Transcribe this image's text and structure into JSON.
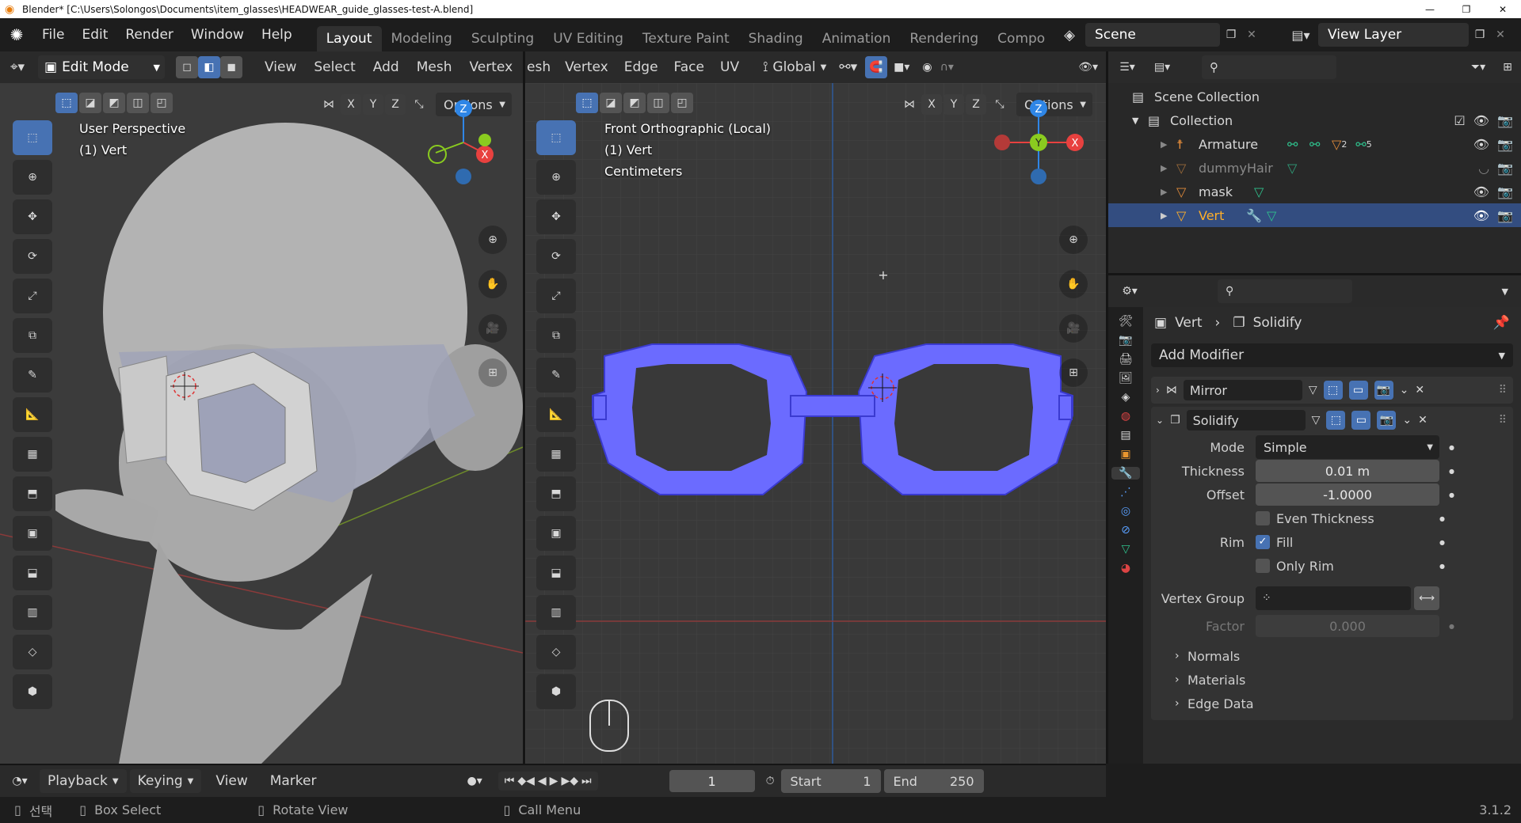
{
  "titlebar": {
    "text": "Blender* [C:\\Users\\Solongos\\Documents\\item_glasses\\HEADWEAR_guide_glasses-test-A.blend]"
  },
  "menu": [
    "File",
    "Edit",
    "Render",
    "Window",
    "Help"
  ],
  "workspaces": [
    "Layout",
    "Modeling",
    "Sculpting",
    "UV Editing",
    "Texture Paint",
    "Shading",
    "Animation",
    "Rendering",
    "Compo"
  ],
  "scene": {
    "name": "Scene",
    "view_layer": "View Layer"
  },
  "left_view": {
    "mode": "Edit Mode",
    "menus": [
      "View",
      "Select",
      "Add",
      "Mesh",
      "Vertex"
    ],
    "options": "Options",
    "info": [
      "User Perspective",
      "(1) Vert"
    ],
    "axes": [
      "X",
      "Y",
      "Z"
    ]
  },
  "right_view": {
    "menus": [
      "esh",
      "Vertex",
      "Edge",
      "Face",
      "UV"
    ],
    "orientation": "Global",
    "options": "Options",
    "info": [
      "Front Orthographic (Local)",
      "(1) Vert",
      "Centimeters"
    ],
    "axes": [
      "X",
      "Y",
      "Z"
    ]
  },
  "gizmo": {
    "x": "X",
    "y": "Y",
    "z": "Z"
  },
  "outliner": {
    "scene_collection": "Scene Collection",
    "collection": "Collection",
    "items": [
      {
        "name": "Armature",
        "badge1": "2",
        "badge2": "5"
      },
      {
        "name": "dummyHair"
      },
      {
        "name": "mask"
      },
      {
        "name": "Vert"
      }
    ]
  },
  "properties": {
    "breadcrumb_object": "Vert",
    "breadcrumb_modifier": "Solidify",
    "add_modifier": "Add Modifier",
    "modifiers": [
      {
        "name": "Mirror"
      },
      {
        "name": "Solidify"
      }
    ],
    "mode_label": "Mode",
    "mode_value": "Simple",
    "thickness_label": "Thickness",
    "thickness_value": "0.01 m",
    "offset_label": "Offset",
    "offset_value": "-1.0000",
    "even_thickness": "Even Thickness",
    "rim_label": "Rim",
    "fill": "Fill",
    "only_rim": "Only Rim",
    "vertex_group": "Vertex Group",
    "factor_label": "Factor",
    "factor_value": "0.000",
    "sections": [
      "Normals",
      "Materials",
      "Edge Data"
    ]
  },
  "timeline": {
    "playback": "Playback",
    "keying": "Keying",
    "view": "View",
    "marker": "Marker",
    "frame": "1",
    "start_label": "Start",
    "start": "1",
    "end_label": "End",
    "end": "250"
  },
  "statusbar": {
    "select": "선택",
    "box_select": "Box Select",
    "rotate_view": "Rotate View",
    "call_menu": "Call Menu",
    "version": "3.1.2"
  },
  "colors": {
    "accent": "#4772b3",
    "x_axis": "#e8413f",
    "y_axis": "#8acb1f",
    "z_axis": "#2f86e6",
    "glasses": "#6b6bff"
  }
}
